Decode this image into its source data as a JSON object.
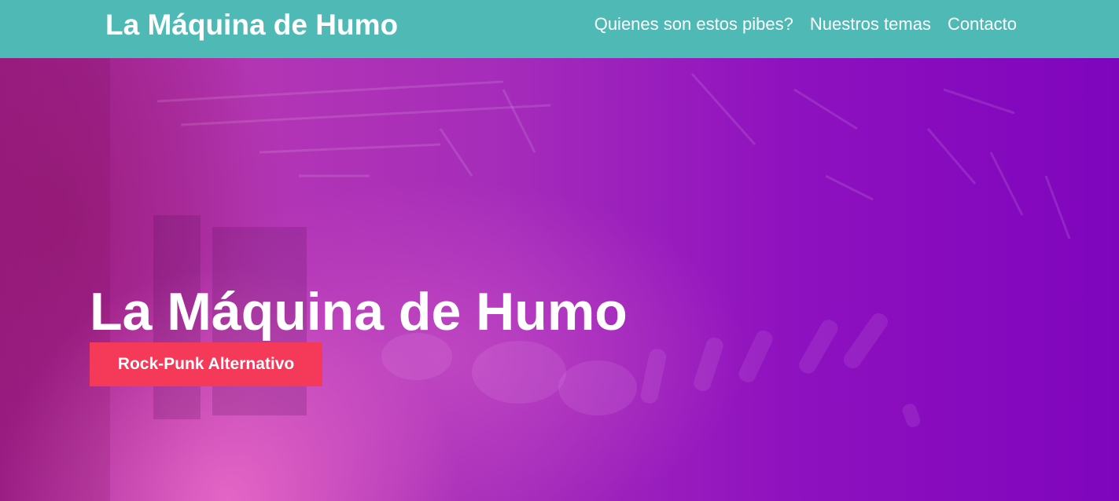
{
  "header": {
    "brand": "La Máquina de Humo",
    "nav": [
      {
        "label": "Quienes son estos pibes?"
      },
      {
        "label": "Nuestros temas"
      },
      {
        "label": "Contacto"
      }
    ]
  },
  "hero": {
    "title": "La Máquina de Humo",
    "tagline": "Rock-Punk Alternativo",
    "background_image": "concert-stage-photo"
  },
  "colors": {
    "header_bg": "#4fbab5",
    "tag_bg": "#f43a58",
    "hero_tint_left": "#a1228f",
    "hero_tint_right": "#7f05bd"
  }
}
